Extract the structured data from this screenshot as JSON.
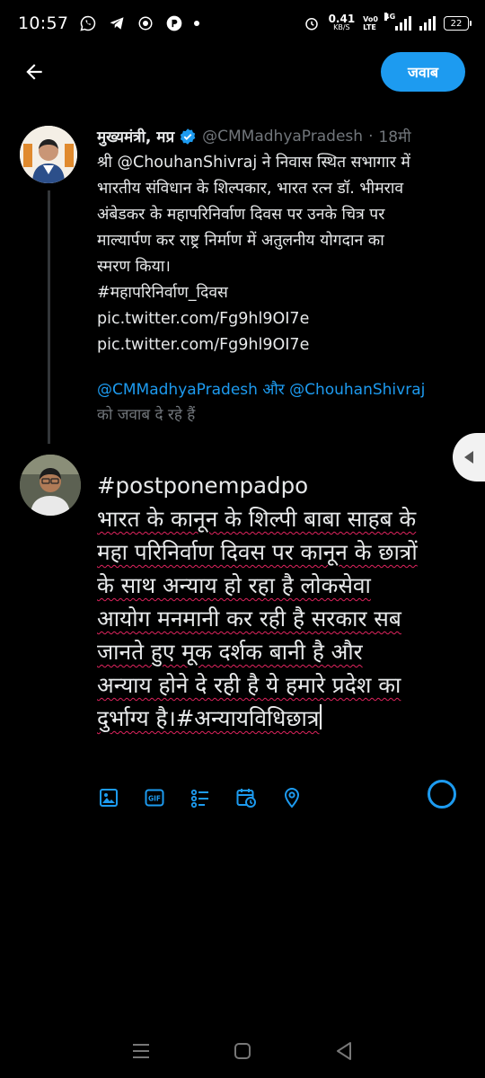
{
  "status_bar": {
    "time": "10:57",
    "net_speed_value": "0.41",
    "net_speed_unit": "KB/S",
    "volte_top": "Vo0",
    "volte_bottom": "LTE",
    "network_type": "4G",
    "battery": "22",
    "left_icons": [
      "whatsapp-icon",
      "telegram-icon",
      "app-icon",
      "paytm-icon",
      "notification-dot"
    ]
  },
  "header": {
    "reply_button": "जवाब"
  },
  "original_tweet": {
    "author_name": "मुख्यमंत्री, मप्र",
    "handle": "@CMMadhyaPradesh",
    "separator": "·",
    "time": "18मी",
    "text_lines": [
      "श्री @ChouhanShivraj ने निवास स्थित सभागार में",
      "भारतीय संविधान के शिल्पकार, भारत रत्न डॉ. भीमराव",
      "अंबेडकर के महापरिनिर्वाण दिवस पर उनके चित्र पर",
      "माल्यार्पण कर राष्ट्र निर्माण में अतुलनीय योगदान का",
      "स्मरण किया।",
      "#महापरिनिर्वाण_दिवस",
      "pic.twitter.com/Fg9hl9OI7e",
      "pic.twitter.com/Fg9hl9OI7e"
    ]
  },
  "replying_to": {
    "mention1": "@CMMadhyaPradesh",
    "conjunction": " और ",
    "mention2": "@ChouhanShivraj",
    "suffix": "को जवाब दे रहे हैं"
  },
  "compose": {
    "hashtag_line": "#postponempadpo",
    "lines": [
      "भारत के कानून के शिल्पी बाबा साहब के",
      "महा परिनिर्वाण दिवस पर कानून के छात्रों",
      "के साथ अन्याय हो रहा है लोकसेवा",
      "आयोग मनमानी कर रही है सरकार सब",
      "जानते हुए मूक दर्शक बानी है और",
      "अन्याय होने दे रही है ये हमारे प्रदेश का",
      "दुर्भाग्य है।#अन्यायविधिछात्र"
    ]
  },
  "toolbar": {
    "gif_label": "GIF",
    "icons": [
      "image-icon",
      "gif-icon",
      "poll-icon",
      "schedule-icon",
      "location-icon"
    ]
  },
  "colors": {
    "accent": "#1d9bf0",
    "background": "#000000",
    "secondary_text": "#71767b",
    "spellcheck": "#e0245e"
  }
}
